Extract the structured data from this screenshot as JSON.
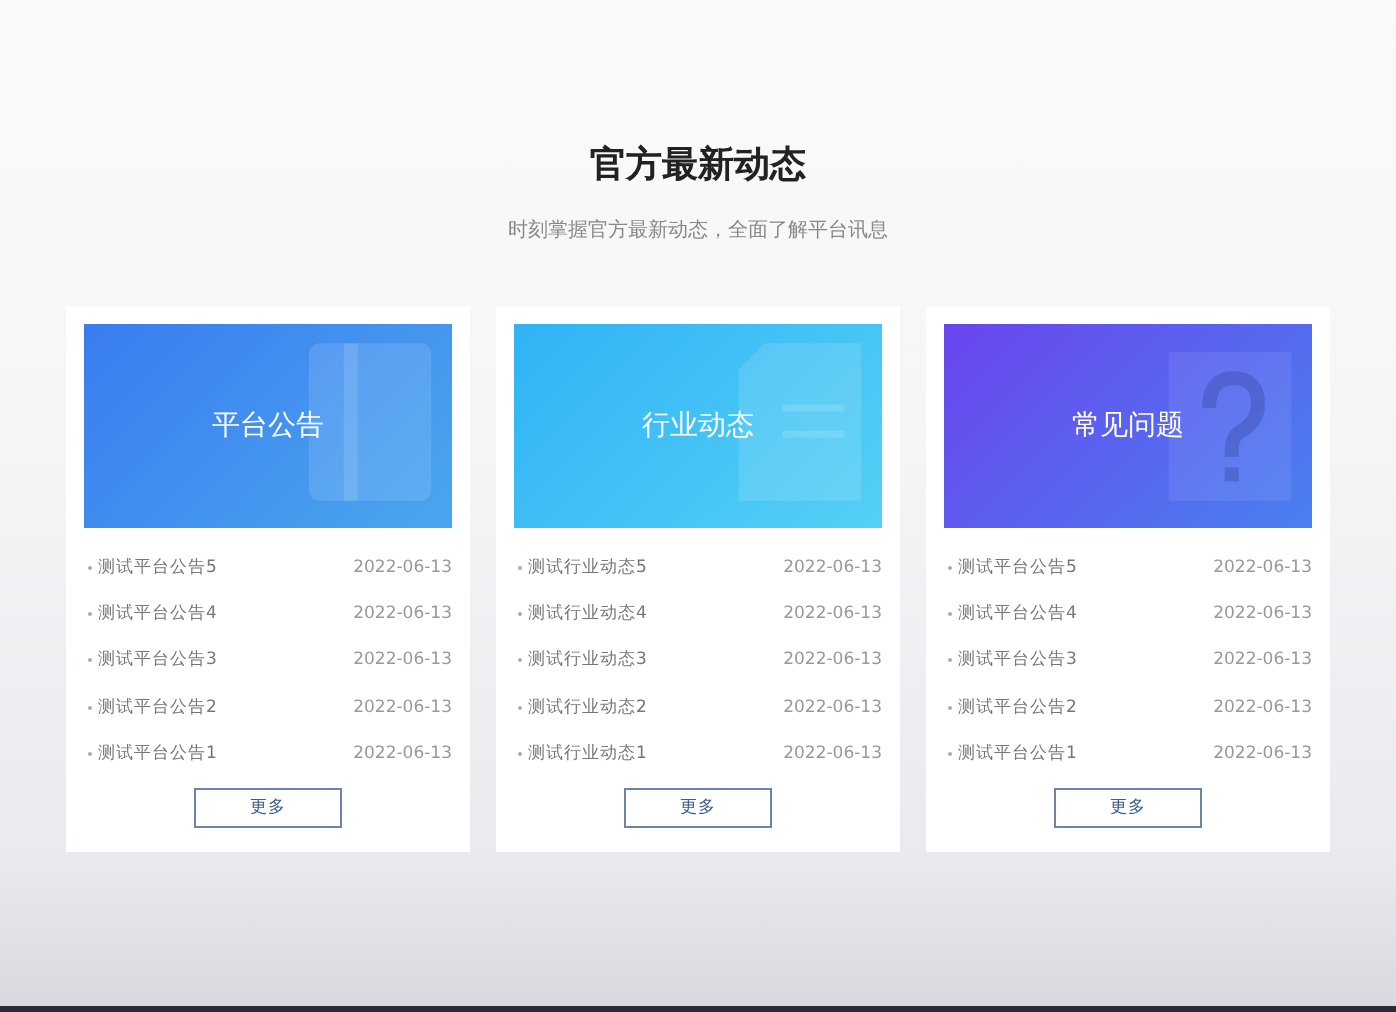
{
  "section": {
    "title": "官方最新动态",
    "subtitle": "时刻掌握官方最新动态，全面了解平台讯息"
  },
  "cards": [
    {
      "kind": "notice",
      "title": "平台公告",
      "items": [
        {
          "title": "测试平台公告5",
          "date": "2022-06-13"
        },
        {
          "title": "测试平台公告4",
          "date": "2022-06-13"
        },
        {
          "title": "测试平台公告3",
          "date": "2022-06-13"
        },
        {
          "title": "测试平台公告2",
          "date": "2022-06-13"
        },
        {
          "title": "测试平台公告1",
          "date": "2022-06-13"
        }
      ],
      "more": "更多"
    },
    {
      "kind": "news",
      "title": "行业动态",
      "items": [
        {
          "title": "测试行业动态5",
          "date": "2022-06-13"
        },
        {
          "title": "测试行业动态4",
          "date": "2022-06-13"
        },
        {
          "title": "测试行业动态3",
          "date": "2022-06-13"
        },
        {
          "title": "测试行业动态2",
          "date": "2022-06-13"
        },
        {
          "title": "测试行业动态1",
          "date": "2022-06-13"
        }
      ],
      "more": "更多"
    },
    {
      "kind": "faq",
      "title": "常见问题",
      "items": [
        {
          "title": "测试平台公告5",
          "date": "2022-06-13"
        },
        {
          "title": "测试平台公告4",
          "date": "2022-06-13"
        },
        {
          "title": "测试平台公告3",
          "date": "2022-06-13"
        },
        {
          "title": "测试平台公告2",
          "date": "2022-06-13"
        },
        {
          "title": "测试平台公告1",
          "date": "2022-06-13"
        }
      ],
      "more": "更多"
    }
  ]
}
